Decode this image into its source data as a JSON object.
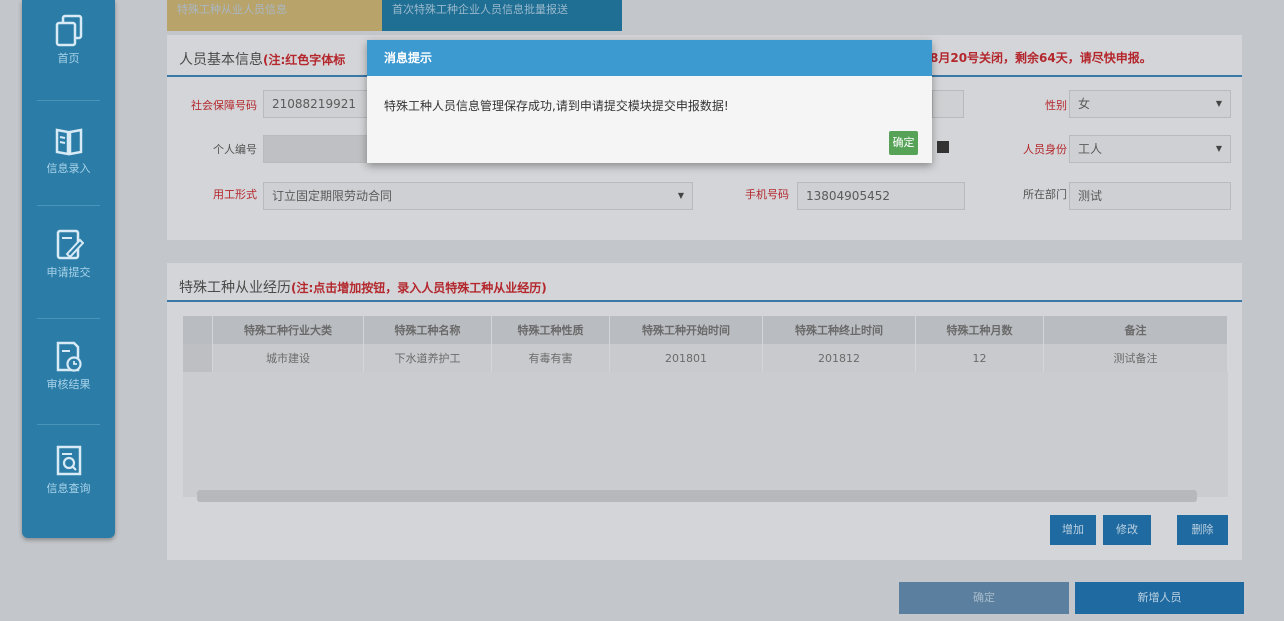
{
  "sidebar": {
    "items": [
      {
        "label": "首页",
        "icon": "copy-icon"
      },
      {
        "label": "信息录入",
        "icon": "book-icon"
      },
      {
        "label": "申请提交",
        "icon": "edit-icon"
      },
      {
        "label": "审核结果",
        "icon": "document-clock-icon"
      },
      {
        "label": "信息查询",
        "icon": "document-search-icon"
      }
    ]
  },
  "tabs": [
    {
      "label": "特殊工种从业人员信息"
    },
    {
      "label": "首次特殊工种企业人员信息批量报送"
    }
  ],
  "basic_info": {
    "title": "人员基本信息",
    "note": "(注:红色字体标",
    "deadline_notice": "8月20号关闭，剩余64天，请尽快申报。",
    "fields": {
      "social_security_label": "社会保障号码",
      "social_security_value": "21088219921",
      "gender_label": "性别",
      "gender_value": "女",
      "personal_no_label": "个人编号",
      "identity_label": "人员身份",
      "identity_value": "工人",
      "employment_label": "用工形式",
      "employment_value": "订立固定期限劳动合同",
      "phone_label": "手机号码",
      "phone_value": "13804905452",
      "dept_label": "所在部门",
      "dept_value": "测试"
    }
  },
  "experience": {
    "title": "特殊工种从业经历",
    "note": "(注:点击增加按钮，录入人员特殊工种从业经历)",
    "columns": [
      "特殊工种行业大类",
      "特殊工种名称",
      "特殊工种性质",
      "特殊工种开始时间",
      "特殊工种终止时间",
      "特殊工种月数",
      "备注"
    ],
    "rows": [
      [
        "城市建设",
        "下水道养护工",
        "有毒有害",
        "201801",
        "201812",
        "12",
        "测试备注"
      ]
    ],
    "buttons": {
      "add": "增加",
      "edit": "修改",
      "delete": "删除"
    }
  },
  "footer": {
    "confirm": "确定",
    "new_person": "新增人员"
  },
  "modal": {
    "title": "消息提示",
    "message": "特殊工种人员信息管理保存成功,请到申请提交模块提交申报数据!",
    "ok": "确定"
  }
}
